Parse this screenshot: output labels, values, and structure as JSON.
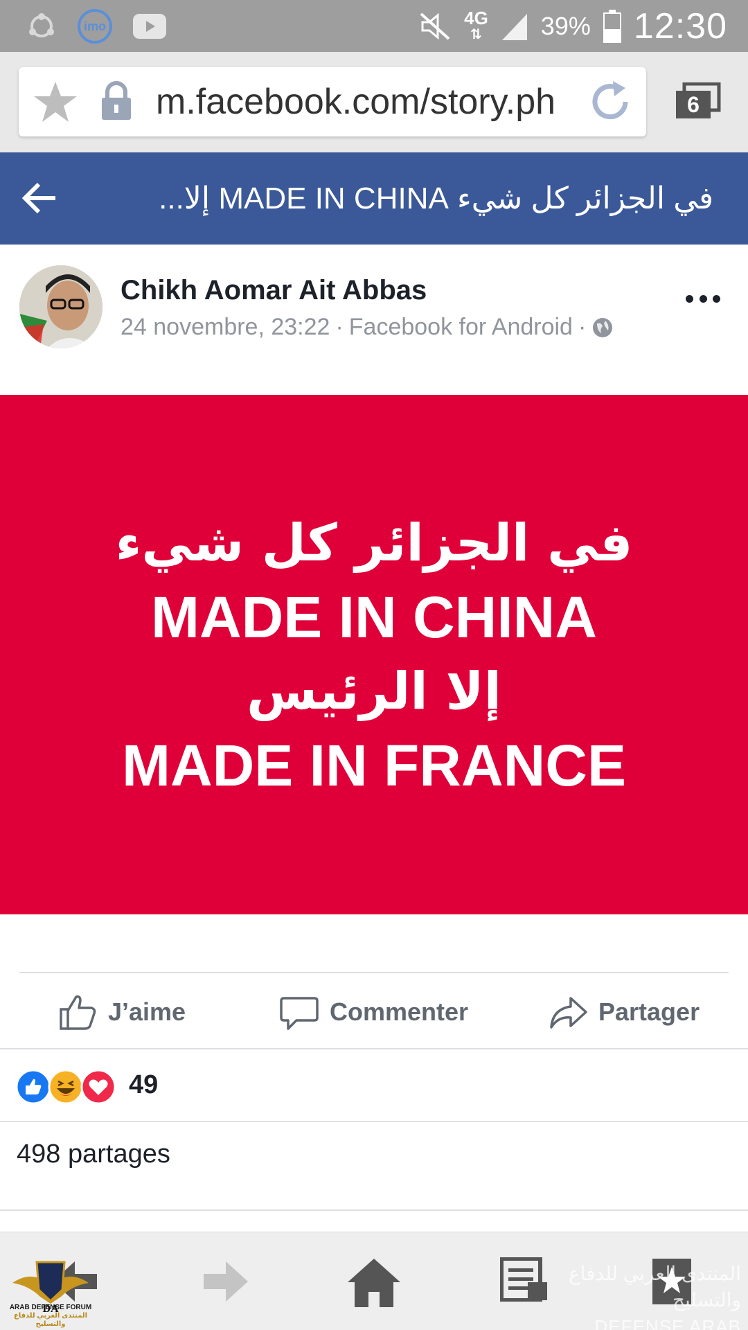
{
  "status_bar": {
    "network": "4G",
    "battery": "39%",
    "time": "12:30",
    "colors": {
      "background": "#9e9e9e",
      "foreground": "#ffffff"
    },
    "left_icons": [
      "sync-icon",
      "imo-app-icon",
      "youtube-icon"
    ],
    "right_icons": [
      "mute-icon",
      "network-4g-icon",
      "signal-icon",
      "battery-icon"
    ],
    "imo_label": "imo"
  },
  "browser": {
    "url": "m.facebook.com/story.ph",
    "tab_count": "6"
  },
  "fb_header": {
    "title": "في الجزائر كل شيء MADE IN CHINA إلا...",
    "background": "#3b5998"
  },
  "post": {
    "author": "Chikh Aomar Ait Abbas",
    "date": "24 novembre, 23:22",
    "separator": "·",
    "source": "Facebook for Android",
    "privacy_icon": "globe-icon",
    "image": {
      "background": "#e00039",
      "lines": [
        "في الجزائر كل شيء",
        "MADE IN CHINA",
        "إلا الرئيس",
        "MADE IN FRANCE"
      ]
    }
  },
  "actions": {
    "like": "J’aime",
    "comment": "Commenter",
    "share": "Partager"
  },
  "reactions": {
    "types": [
      "like",
      "haha",
      "love"
    ],
    "count": "49"
  },
  "shares": "498 partages",
  "bottom_nav": {
    "items": [
      "back-icon",
      "forward-icon",
      "home-icon",
      "bookmarks-list-icon",
      "bookmark-star-icon"
    ]
  },
  "watermark": {
    "arabic": "المنتدى العربي للدفاع والتسليح",
    "english": "DEFENSE ARAB FORUM",
    "logo_line1": "ARAB DEFENSE FORUM",
    "logo_line2": "المنتدى العربي للدفاع والتسليح",
    "logo_initials": "DA"
  }
}
